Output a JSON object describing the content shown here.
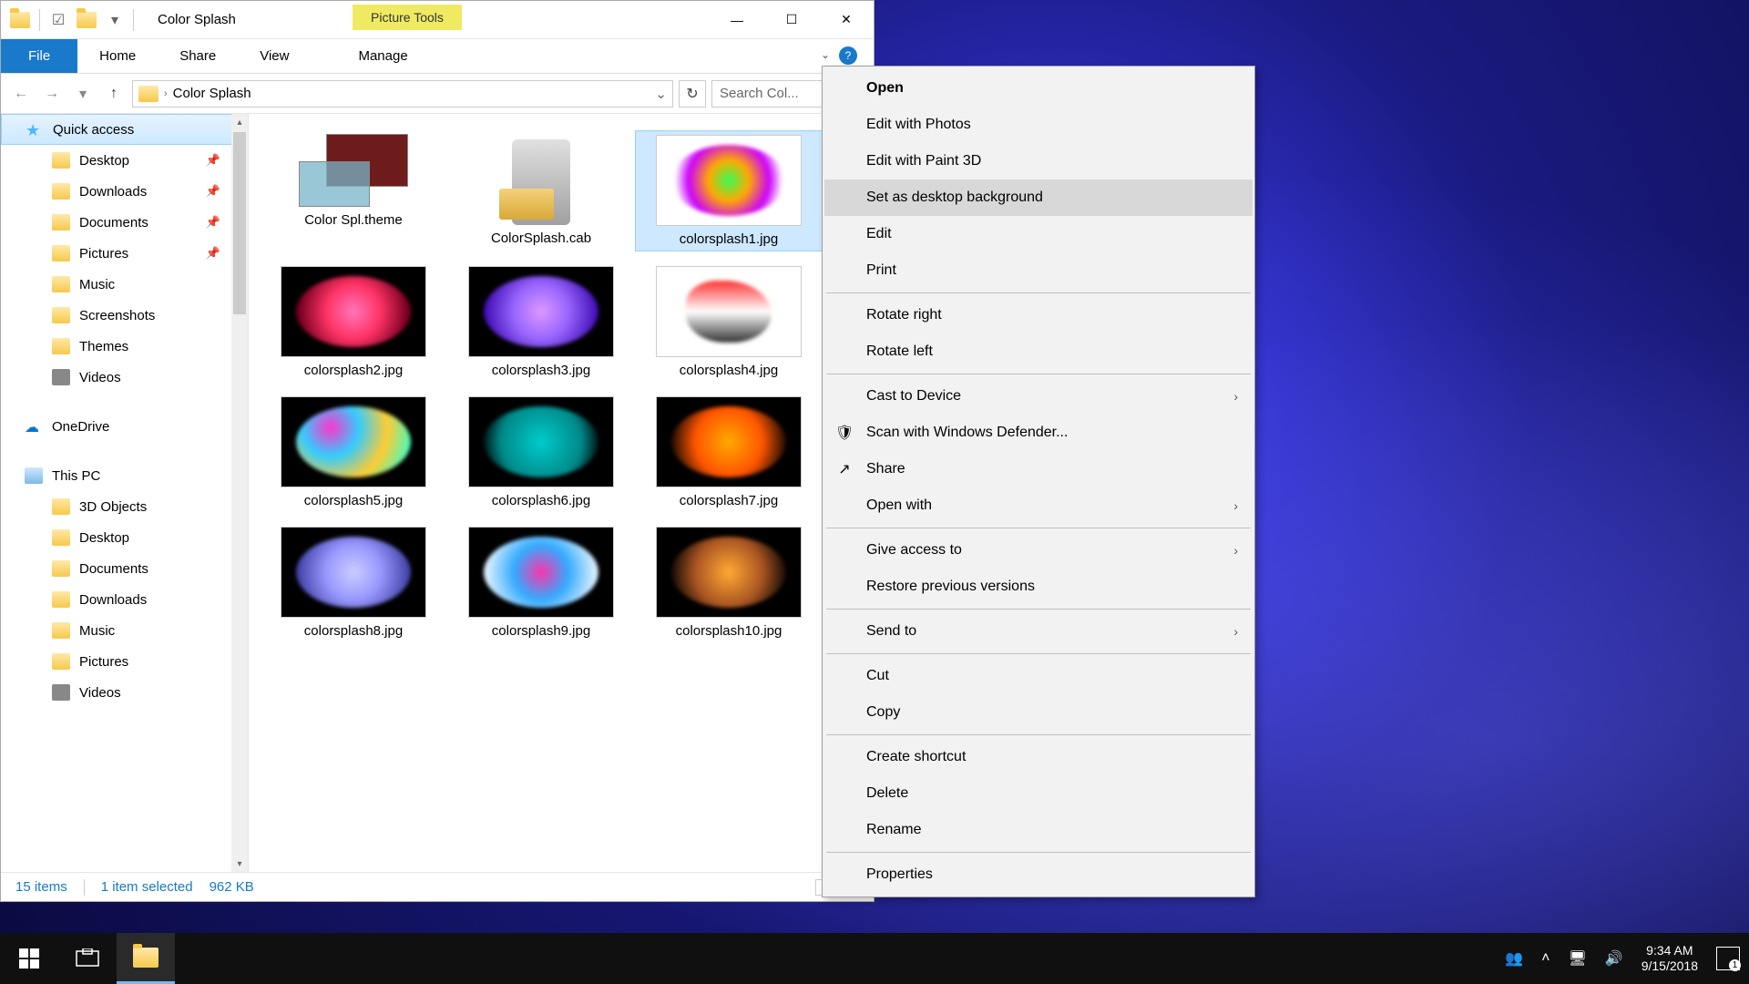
{
  "window": {
    "title": "Color Splash",
    "picture_tools": "Picture Tools",
    "tabs": {
      "file": "File",
      "home": "Home",
      "share": "Share",
      "view": "View",
      "manage": "Manage"
    },
    "breadcrumb": "Color Splash",
    "search_placeholder": "Search Col...",
    "min_tip": "—",
    "max_tip": "☐",
    "close_tip": "✕"
  },
  "sidebar": [
    {
      "label": "Quick access",
      "icon": "star",
      "selected": true
    },
    {
      "label": "Desktop",
      "icon": "folder",
      "pinned": true,
      "indent": true
    },
    {
      "label": "Downloads",
      "icon": "folder",
      "pinned": true,
      "indent": true
    },
    {
      "label": "Documents",
      "icon": "folder",
      "pinned": true,
      "indent": true
    },
    {
      "label": "Pictures",
      "icon": "folder",
      "pinned": true,
      "indent": true
    },
    {
      "label": "Music",
      "icon": "folder",
      "indent": true
    },
    {
      "label": "Screenshots",
      "icon": "folder",
      "indent": true
    },
    {
      "label": "Themes",
      "icon": "folder",
      "indent": true
    },
    {
      "label": "Videos",
      "icon": "video",
      "indent": true
    },
    {
      "spacer": true
    },
    {
      "label": "OneDrive",
      "icon": "onedrive"
    },
    {
      "spacer": true
    },
    {
      "label": "This PC",
      "icon": "pc"
    },
    {
      "label": "3D Objects",
      "icon": "folder",
      "indent": true
    },
    {
      "label": "Desktop",
      "icon": "folder",
      "indent": true
    },
    {
      "label": "Documents",
      "icon": "folder",
      "indent": true
    },
    {
      "label": "Downloads",
      "icon": "folder",
      "indent": true
    },
    {
      "label": "Music",
      "icon": "folder",
      "indent": true
    },
    {
      "label": "Pictures",
      "icon": "folder",
      "indent": true
    },
    {
      "label": "Videos",
      "icon": "video",
      "indent": true
    }
  ],
  "files": [
    {
      "name": "Color Spl.theme",
      "kind": "theme"
    },
    {
      "name": "ColorSplash.cab",
      "kind": "cab"
    },
    {
      "name": "colorsplash1.jpg",
      "kind": "img",
      "cls": "s1",
      "white": true,
      "selected": true
    },
    {
      "name": "colorsplash2.jpg",
      "kind": "img",
      "cls": "s2"
    },
    {
      "name": "colorsplash3.jpg",
      "kind": "img",
      "cls": "s3"
    },
    {
      "name": "colorsplash4.jpg",
      "kind": "img",
      "cls": "s4",
      "white": true
    },
    {
      "name": "colorsplash5.jpg",
      "kind": "img",
      "cls": "s5"
    },
    {
      "name": "colorsplash6.jpg",
      "kind": "img",
      "cls": "s6"
    },
    {
      "name": "colorsplash7.jpg",
      "kind": "img",
      "cls": "s7"
    },
    {
      "name": "colorsplash8.jpg",
      "kind": "img",
      "cls": "s8"
    },
    {
      "name": "colorsplash9.jpg",
      "kind": "img",
      "cls": "s9"
    },
    {
      "name": "colorsplash10.jpg",
      "kind": "img",
      "cls": "s10"
    }
  ],
  "status": {
    "count": "15 items",
    "selected": "1 item selected",
    "size": "962 KB"
  },
  "context_menu": [
    {
      "label": "Open",
      "bold": true
    },
    {
      "label": "Edit with Photos"
    },
    {
      "label": "Edit with Paint 3D"
    },
    {
      "label": "Set as desktop background",
      "hover": true
    },
    {
      "label": "Edit"
    },
    {
      "label": "Print"
    },
    {
      "sep": true
    },
    {
      "label": "Rotate right"
    },
    {
      "label": "Rotate left"
    },
    {
      "sep": true
    },
    {
      "label": "Cast to Device",
      "arrow": true
    },
    {
      "label": "Scan with Windows Defender...",
      "icon": "shield"
    },
    {
      "label": "Share",
      "icon": "share"
    },
    {
      "label": "Open with",
      "arrow": true
    },
    {
      "sep": true
    },
    {
      "label": "Give access to",
      "arrow": true
    },
    {
      "label": "Restore previous versions"
    },
    {
      "sep": true
    },
    {
      "label": "Send to",
      "arrow": true
    },
    {
      "sep": true
    },
    {
      "label": "Cut"
    },
    {
      "label": "Copy"
    },
    {
      "sep": true
    },
    {
      "label": "Create shortcut"
    },
    {
      "label": "Delete"
    },
    {
      "label": "Rename"
    },
    {
      "sep": true
    },
    {
      "label": "Properties"
    }
  ],
  "taskbar": {
    "time": "9:34 AM",
    "date": "9/15/2018"
  }
}
